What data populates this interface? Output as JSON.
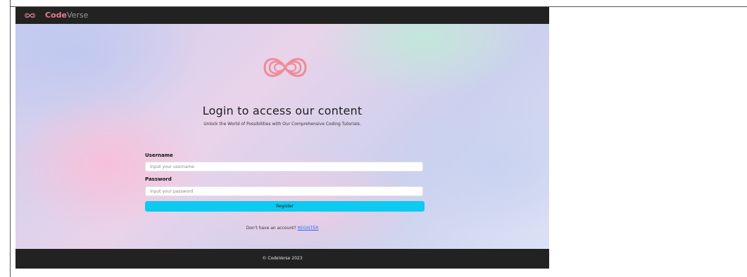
{
  "navbar": {
    "logo_icon": "infinity-logo-icon",
    "brand_part1": "Code",
    "brand_part2": "Verse"
  },
  "hero": {
    "logo_icon": "infinity-logo-icon",
    "title": "Login to access our content",
    "subtitle": "Unlock the World of Possibilities with Our Comprehensive Coding Tutorials."
  },
  "form": {
    "username_label": "Username",
    "username_placeholder": "Input your username",
    "username_value": "",
    "password_label": "Password",
    "password_placeholder": "Input your password",
    "password_value": "",
    "submit_label": "Register"
  },
  "signup": {
    "prompt": "Don't have an account?",
    "link_label": "REGISTER"
  },
  "footer": {
    "copyright": "© CodeVerse 2023"
  },
  "colors": {
    "navbar_bg": "#222222",
    "brand_accent": "#f07a8a",
    "logo": "#f08a96",
    "button": "#0dcaf0",
    "link": "#2a6cff"
  }
}
